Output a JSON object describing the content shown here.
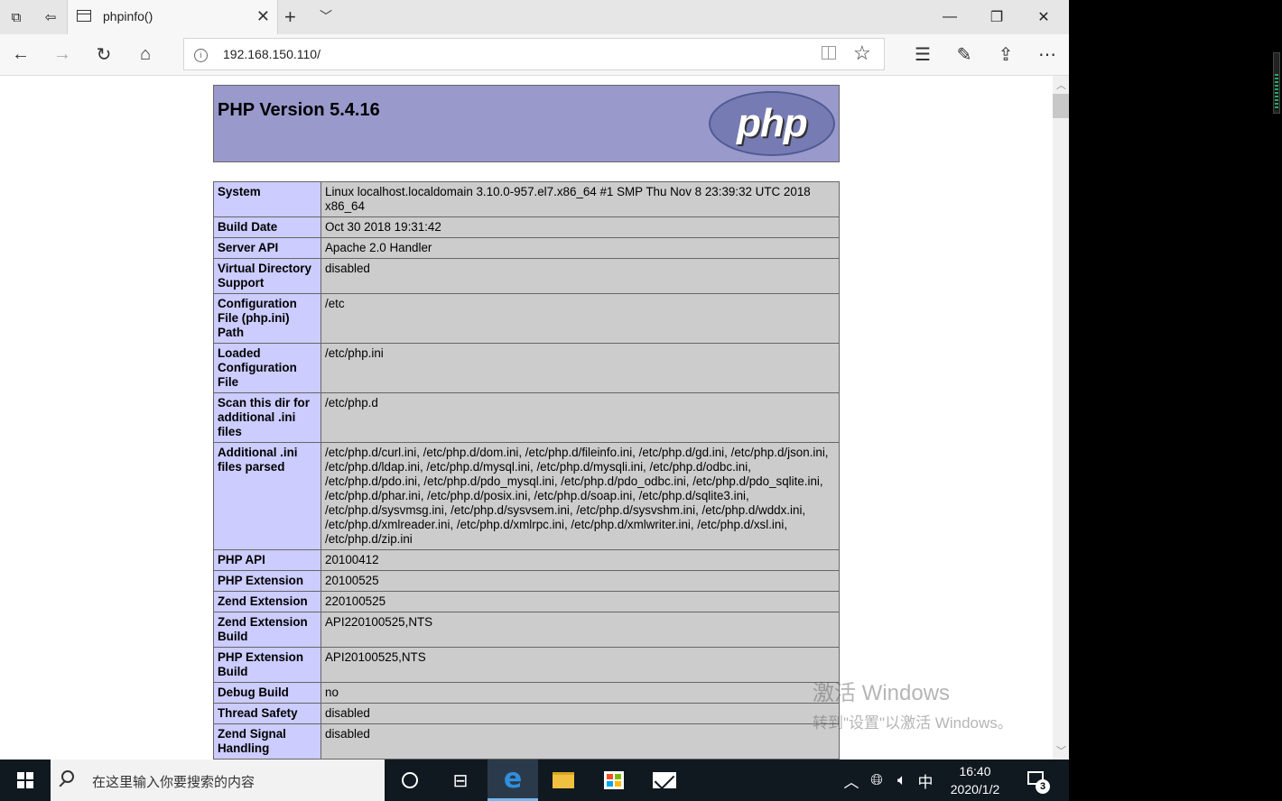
{
  "browser": {
    "tab_title": "phpinfo()",
    "address": "192.168.150.110/",
    "new_tab_symbol": "+",
    "tab_close_symbol": "✕"
  },
  "page": {
    "title": "PHP Version 5.4.16",
    "logo_text": "php",
    "rows": [
      {
        "k": "System",
        "v": "Linux localhost.localdomain 3.10.0-957.el7.x86_64 #1 SMP Thu Nov 8 23:39:32 UTC 2018 x86_64"
      },
      {
        "k": "Build Date",
        "v": "Oct 30 2018 19:31:42"
      },
      {
        "k": "Server API",
        "v": "Apache 2.0 Handler"
      },
      {
        "k": "Virtual Directory Support",
        "v": "disabled"
      },
      {
        "k": "Configuration File (php.ini) Path",
        "v": "/etc"
      },
      {
        "k": "Loaded Configuration File",
        "v": "/etc/php.ini"
      },
      {
        "k": "Scan this dir for additional .ini files",
        "v": "/etc/php.d"
      },
      {
        "k": "Additional .ini files parsed",
        "v": "/etc/php.d/curl.ini, /etc/php.d/dom.ini, /etc/php.d/fileinfo.ini, /etc/php.d/gd.ini, /etc/php.d/json.ini, /etc/php.d/ldap.ini, /etc/php.d/mysql.ini, /etc/php.d/mysqli.ini, /etc/php.d/odbc.ini, /etc/php.d/pdo.ini, /etc/php.d/pdo_mysql.ini, /etc/php.d/pdo_odbc.ini, /etc/php.d/pdo_sqlite.ini, /etc/php.d/phar.ini, /etc/php.d/posix.ini, /etc/php.d/soap.ini, /etc/php.d/sqlite3.ini, /etc/php.d/sysvmsg.ini, /etc/php.d/sysvsem.ini, /etc/php.d/sysvshm.ini, /etc/php.d/wddx.ini, /etc/php.d/xmlreader.ini, /etc/php.d/xmlrpc.ini, /etc/php.d/xmlwriter.ini, /etc/php.d/xsl.ini, /etc/php.d/zip.ini"
      },
      {
        "k": "PHP API",
        "v": "20100412"
      },
      {
        "k": "PHP Extension",
        "v": "20100525"
      },
      {
        "k": "Zend Extension",
        "v": "220100525"
      },
      {
        "k": "Zend Extension Build",
        "v": "API220100525,NTS"
      },
      {
        "k": "PHP Extension Build",
        "v": "API20100525,NTS"
      },
      {
        "k": "Debug Build",
        "v": "no"
      },
      {
        "k": "Thread Safety",
        "v": "disabled"
      },
      {
        "k": "Zend Signal Handling",
        "v": "disabled"
      }
    ]
  },
  "watermark": {
    "line1": "激活 Windows",
    "line2": "转到\"设置\"以激活 Windows。"
  },
  "taskbar": {
    "search_placeholder": "在这里输入你要搜索的内容",
    "ime": "中",
    "time": "16:40",
    "date": "2020/1/2",
    "notification_count": "3"
  }
}
